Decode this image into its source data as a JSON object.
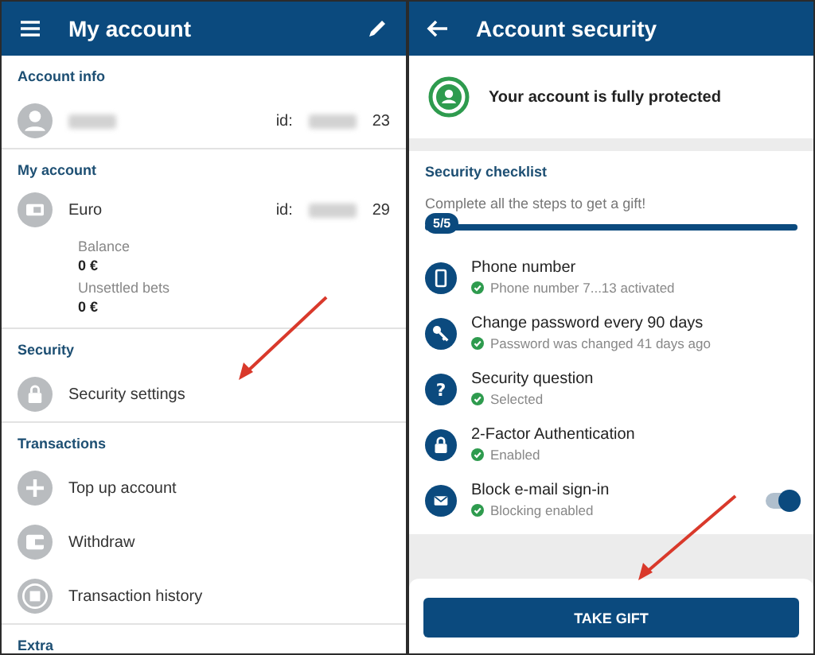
{
  "left": {
    "title": "My account",
    "sections": [
      {
        "heading": "Account info",
        "items": [
          {
            "kind": "profile",
            "id_label": "id:",
            "id_suffix": "23"
          }
        ]
      },
      {
        "heading": "My account",
        "items": [
          {
            "kind": "wallet",
            "label": "Euro",
            "id_label": "id:",
            "id_suffix": "29",
            "fields": [
              {
                "label": "Balance",
                "value": "0 €"
              },
              {
                "label": "Unsettled bets",
                "value": "0 €"
              }
            ]
          }
        ]
      },
      {
        "heading": "Security",
        "items": [
          {
            "kind": "lock",
            "label": "Security settings"
          }
        ]
      },
      {
        "heading": "Transactions",
        "items": [
          {
            "kind": "plus",
            "label": "Top up account"
          },
          {
            "kind": "card",
            "label": "Withdraw"
          },
          {
            "kind": "history",
            "label": "Transaction history"
          }
        ]
      },
      {
        "heading": "Extra"
      }
    ]
  },
  "right": {
    "title": "Account security",
    "status": "Your account is fully protected",
    "checklist": {
      "heading": "Security checklist",
      "hint": "Complete all the steps to get a gift!",
      "progress_label": "5/5",
      "level": 1,
      "items": [
        {
          "kind": "phone",
          "title": "Phone number",
          "status": "Phone number 7...13 activated",
          "done": true
        },
        {
          "kind": "key",
          "title": "Change password every 90 days",
          "status": "Password was changed 41 days ago",
          "done": true
        },
        {
          "kind": "question",
          "glyph": "?",
          "title": "Security question",
          "status": "Selected",
          "done": true
        },
        {
          "kind": "lock",
          "title": "2-Factor Authentication",
          "status": "Enabled",
          "done": true
        },
        {
          "kind": "mail",
          "title": "Block e-mail sign-in",
          "status": "Blocking enabled",
          "done": true,
          "toggle": {
            "on": true
          }
        }
      ]
    },
    "button": "TAKE GIFT"
  }
}
